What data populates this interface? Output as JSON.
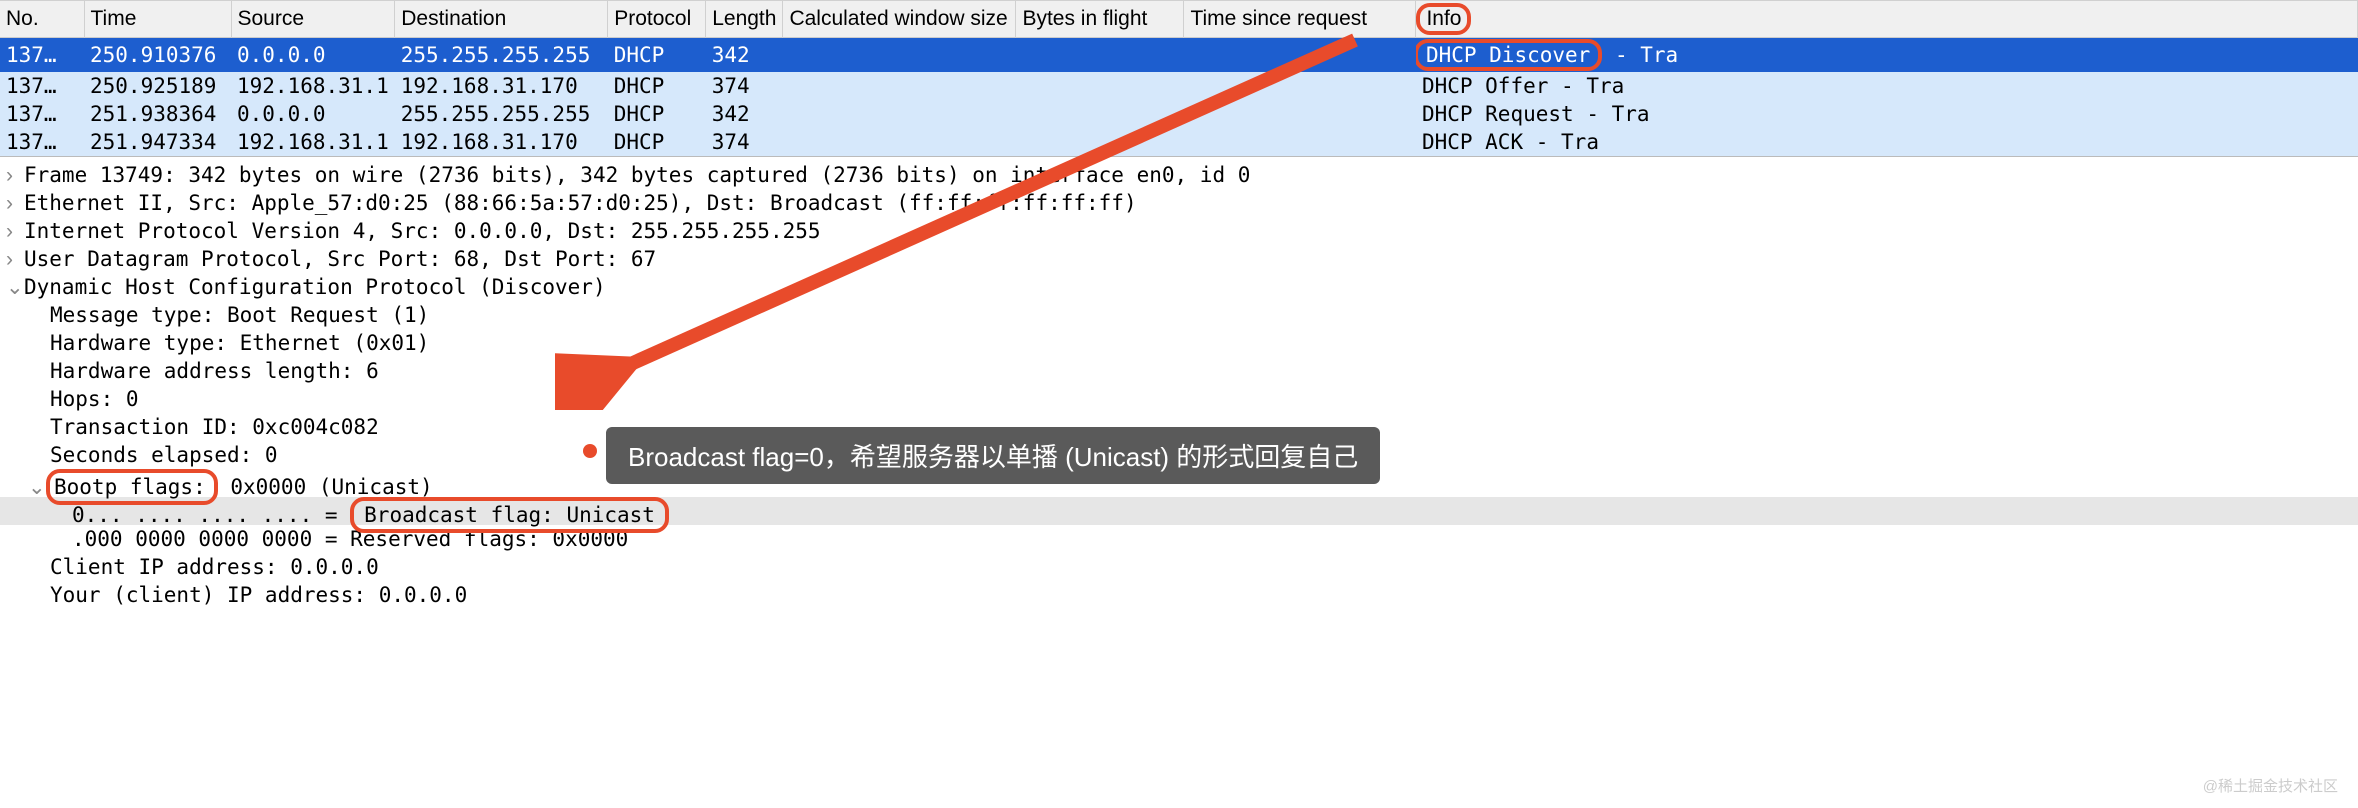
{
  "columns": {
    "no": "No.",
    "time": "Time",
    "src": "Source",
    "dst": "Destination",
    "proto": "Protocol",
    "len": "Length",
    "win": "Calculated window size",
    "bytes": "Bytes in flight",
    "since": "Time since request",
    "info": "Info"
  },
  "rows": [
    {
      "no": "137…",
      "time": "250.910376",
      "src": "0.0.0.0",
      "dst": "255.255.255.255",
      "proto": "DHCP",
      "len": "342",
      "win": "",
      "bytes": "",
      "since": "",
      "info_a": "DHCP Discover",
      "info_b": " - Tra",
      "class": "row-selected"
    },
    {
      "no": "137…",
      "time": "250.925189",
      "src": "192.168.31.1",
      "dst": "192.168.31.170",
      "proto": "DHCP",
      "len": "374",
      "win": "",
      "bytes": "",
      "since": "",
      "info_a": "DHCP Offer    - Tra",
      "info_b": "",
      "class": "row-related"
    },
    {
      "no": "137…",
      "time": "251.938364",
      "src": "0.0.0.0",
      "dst": "255.255.255.255",
      "proto": "DHCP",
      "len": "342",
      "win": "",
      "bytes": "",
      "since": "",
      "info_a": "DHCP Request  - Tra",
      "info_b": "",
      "class": "row-related"
    },
    {
      "no": "137…",
      "time": "251.947334",
      "src": "192.168.31.1",
      "dst": "192.168.31.170",
      "proto": "DHCP",
      "len": "374",
      "win": "",
      "bytes": "",
      "since": "",
      "info_a": "DHCP ACK      - Tra",
      "info_b": "",
      "class": "row-related"
    }
  ],
  "details": {
    "frame": "Frame 13749: 342 bytes on wire (2736 bits), 342 bytes captured (2736 bits) on interface en0, id 0",
    "eth": "Ethernet II, Src: Apple_57:d0:25 (88:66:5a:57:d0:25), Dst: Broadcast (ff:ff:ff:ff:ff:ff)",
    "ip": "Internet Protocol Version 4, Src: 0.0.0.0, Dst: 255.255.255.255",
    "udp": "User Datagram Protocol, Src Port: 68, Dst Port: 67",
    "dhcp": "Dynamic Host Configuration Protocol (Discover)",
    "msg_type": "Message type: Boot Request (1)",
    "hw_type": "Hardware type: Ethernet (0x01)",
    "hw_len": "Hardware address length: 6",
    "hops": "Hops: 0",
    "txid": "Transaction ID: 0xc004c082",
    "secs": "Seconds elapsed: 0",
    "bootp_label": "Bootp flags:",
    "bootp_val": " 0x0000 (Unicast)",
    "bcast_bits": "0... .... .... .... = ",
    "bcast_label": "Broadcast flag: Unicast",
    "reserved": ".000 0000 0000 0000 = Reserved flags: 0x0000",
    "ciaddr": "Client IP address: 0.0.0.0",
    "yiaddr": "Your (client) IP address: 0.0.0.0"
  },
  "annotation": "Broadcast flag=0，希望服务器以单播 (Unicast) 的形式回复自己",
  "watermark": "@稀土掘金技术社区"
}
